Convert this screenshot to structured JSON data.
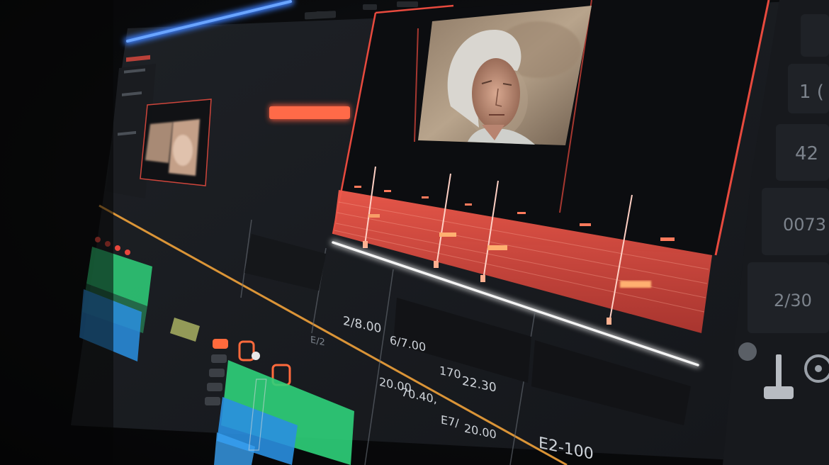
{
  "timecodes": {
    "tc_1": "2/8.00",
    "tc_2": "6/7.00",
    "tc_3": "170",
    "tc_4": "22.30",
    "tc_5": "20.00",
    "tc_6": "70.40,",
    "tc_7": "E7/",
    "tc_8": "20.00",
    "tc_9": "E2-100",
    "tc_10": "E/2"
  },
  "side_panel": {
    "readout_1": "1 (",
    "readout_2": "42",
    "readout_3": "0073",
    "readout_4": "2/30"
  },
  "colors": {
    "selection_red": "#e8473c",
    "clip_green": "#2fd17a",
    "clip_blue": "#2a8fe0",
    "playhead_orange": "#f0a23a",
    "top_bar_blue": "#3a7fff"
  }
}
